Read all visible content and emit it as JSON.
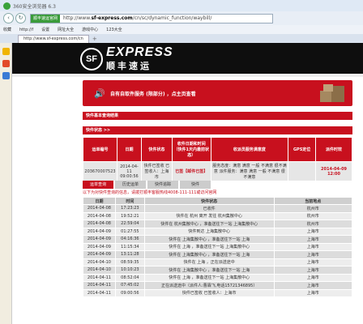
{
  "browser": {
    "title": "360安全浏览器 6.3",
    "secure_label": "顺丰速运官网",
    "url_prefix": "http://www.",
    "url_domain": "sf-express.com",
    "url_path": "/cn/sc/dynamic_function/waybill/",
    "bookmarks": [
      "收藏",
      "http://f",
      "设置",
      "网址大全",
      "游戏中心",
      "123大全"
    ],
    "tab_label": "http://www.sf-express.com/cn",
    "new_tab": "+"
  },
  "brand": {
    "logo_mark": "SF",
    "en": "EXPRESS",
    "cn": "顺丰速运"
  },
  "promo": {
    "icon": "speaker-icon",
    "text": "自有自取件服务 (限部分) ，点主页查看"
  },
  "section1_title": "快件基本查询结果",
  "section2_title": "快件状态 >>",
  "summary": {
    "headers": [
      "运单编号",
      "日期",
      "快件状态",
      "收件日期和时间（快件1天内最前状态）",
      "收派员服务满意度",
      "GPS定位",
      "派件时效"
    ],
    "row": [
      "203670007523",
      "2014-04-11 09:00:56",
      "快件已签收 已签收人：上海市",
      "已签【邮件已签】",
      "服务态度：满意 满意 一般 不满意 很不满意 派件服务：满意 满意 一般 不满意 很不满意",
      "",
      "2014-04-09 12:00"
    ]
  },
  "tabs": [
    "运单查询",
    "历史运单",
    "快件追踪",
    "快件"
  ],
  "notice": "以下为对快件查询的信息，请拨打顺丰客服热线4008-111-111或访问官网",
  "detail": {
    "headers": [
      "日期",
      "时间",
      "快件状态",
      "当前地点"
    ],
    "rows": [
      [
        "2014-04-08",
        "17:23:23",
        "已收件",
        "杭州市"
      ],
      [
        "2014-04-08",
        "19:52:21",
        "快件在 杭州 离开 发往 杭州集散中心",
        "杭州市"
      ],
      [
        "2014-04-08",
        "22:59:04",
        "快件在 杭州集散中心 ，准备送往下一站 上海集散中心",
        "杭州市"
      ],
      [
        "2014-04-09",
        "01:27:55",
        "快件到达 上海集散中心",
        "上海市"
      ],
      [
        "2014-04-09",
        "04:16:36",
        "快件在 上海集散中心 ，准备送往下一站 上海",
        "上海市"
      ],
      [
        "2014-04-09",
        "11:15:34",
        "快件在 上海 ，准备送往下一站 上海集散中心",
        "上海市"
      ],
      [
        "2014-04-09",
        "13:11:28",
        "快件在 上海集散中心 ，准备送往下一站 上海",
        "上海市"
      ],
      [
        "2014-04-10",
        "08:59:35",
        "快件在 上海 ，正在派送途中",
        "上海市"
      ],
      [
        "2014-04-10",
        "10:10:23",
        "快件在 上海集散中心 ，准备送往下一站 上海",
        "上海市"
      ],
      [
        "2014-04-11",
        "08:52:04",
        "快件在 上海 ，准备送往下一站 上海集散中心",
        "上海市"
      ],
      [
        "2014-04-11",
        "07:45:02",
        "正在派送途中（派件人:曹霖飞,电话15721346895）",
        "上海市"
      ],
      [
        "2014-04-11",
        "09:00:56",
        "快件已签收 已签收人：上海市",
        "上海市"
      ]
    ]
  },
  "colors": {
    "sf_red": "#c8101e",
    "banner_black": "#0e0e0e"
  }
}
